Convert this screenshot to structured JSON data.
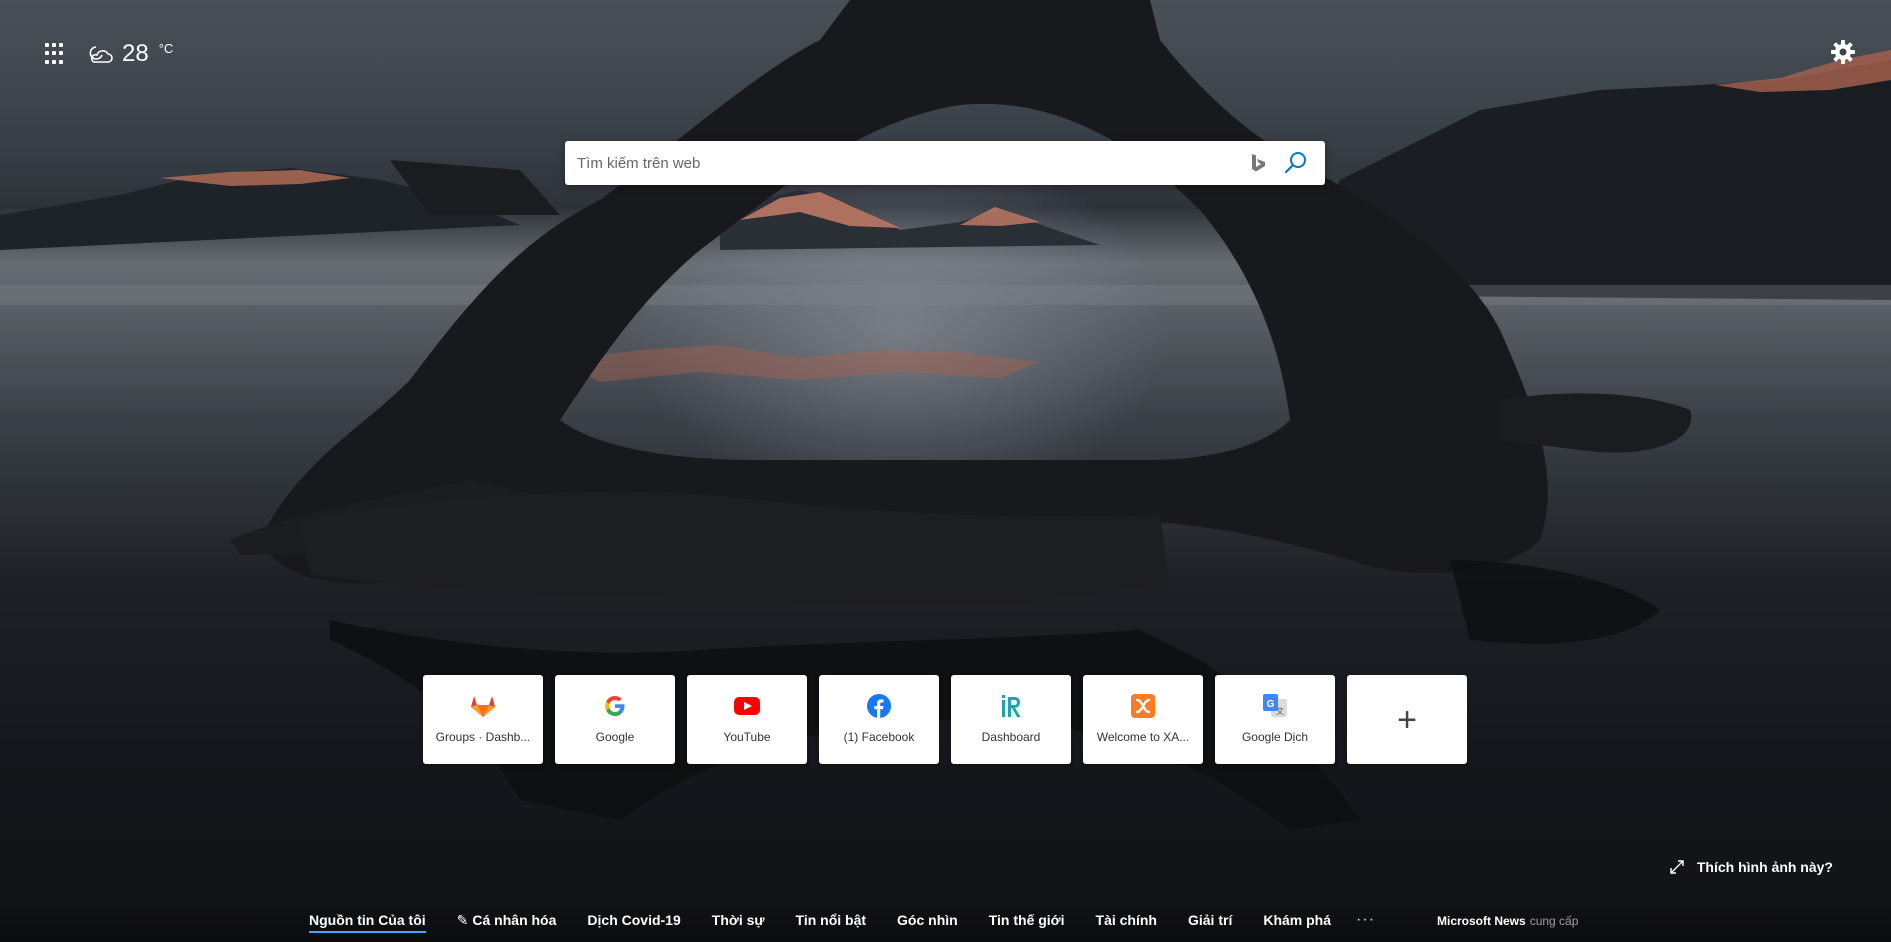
{
  "weather": {
    "temperature": "28",
    "unit": "°C",
    "icon": "partly-cloudy-night-icon"
  },
  "search": {
    "placeholder": "Tìm kiếm trên web"
  },
  "tiles": [
    {
      "label": "Groups · Dashb...",
      "icon": "gitlab-icon"
    },
    {
      "label": "Google",
      "icon": "google-icon"
    },
    {
      "label": "YouTube",
      "icon": "youtube-icon"
    },
    {
      "label": "(1) Facebook",
      "icon": "facebook-icon"
    },
    {
      "label": "Dashboard",
      "icon": "ir-logo-icon"
    },
    {
      "label": "Welcome to XA...",
      "icon": "xampp-icon"
    },
    {
      "label": "Google Dịch",
      "icon": "google-translate-icon"
    }
  ],
  "add_tile": {
    "symbol": "+"
  },
  "like_photo": {
    "label": "Thích hình ảnh này?"
  },
  "news_nav": {
    "items": [
      "Nguồn tin Của tôi",
      "Cá nhân hóa",
      "Dịch Covid-19",
      "Thời sự",
      "Tin nổi bật",
      "Góc nhìn",
      "Tin thế giới",
      "Tài chính",
      "Giải trí",
      "Khám phá"
    ],
    "more": "···",
    "active_index": 0
  },
  "provider": {
    "brand": "Microsoft News",
    "suffix": "cung cấp"
  },
  "colors": {
    "accent": "#4aa3ff",
    "gitlab": "#e24329",
    "youtube": "#ff0000",
    "facebook": "#1877f2",
    "xampp": "#fb7a24"
  }
}
